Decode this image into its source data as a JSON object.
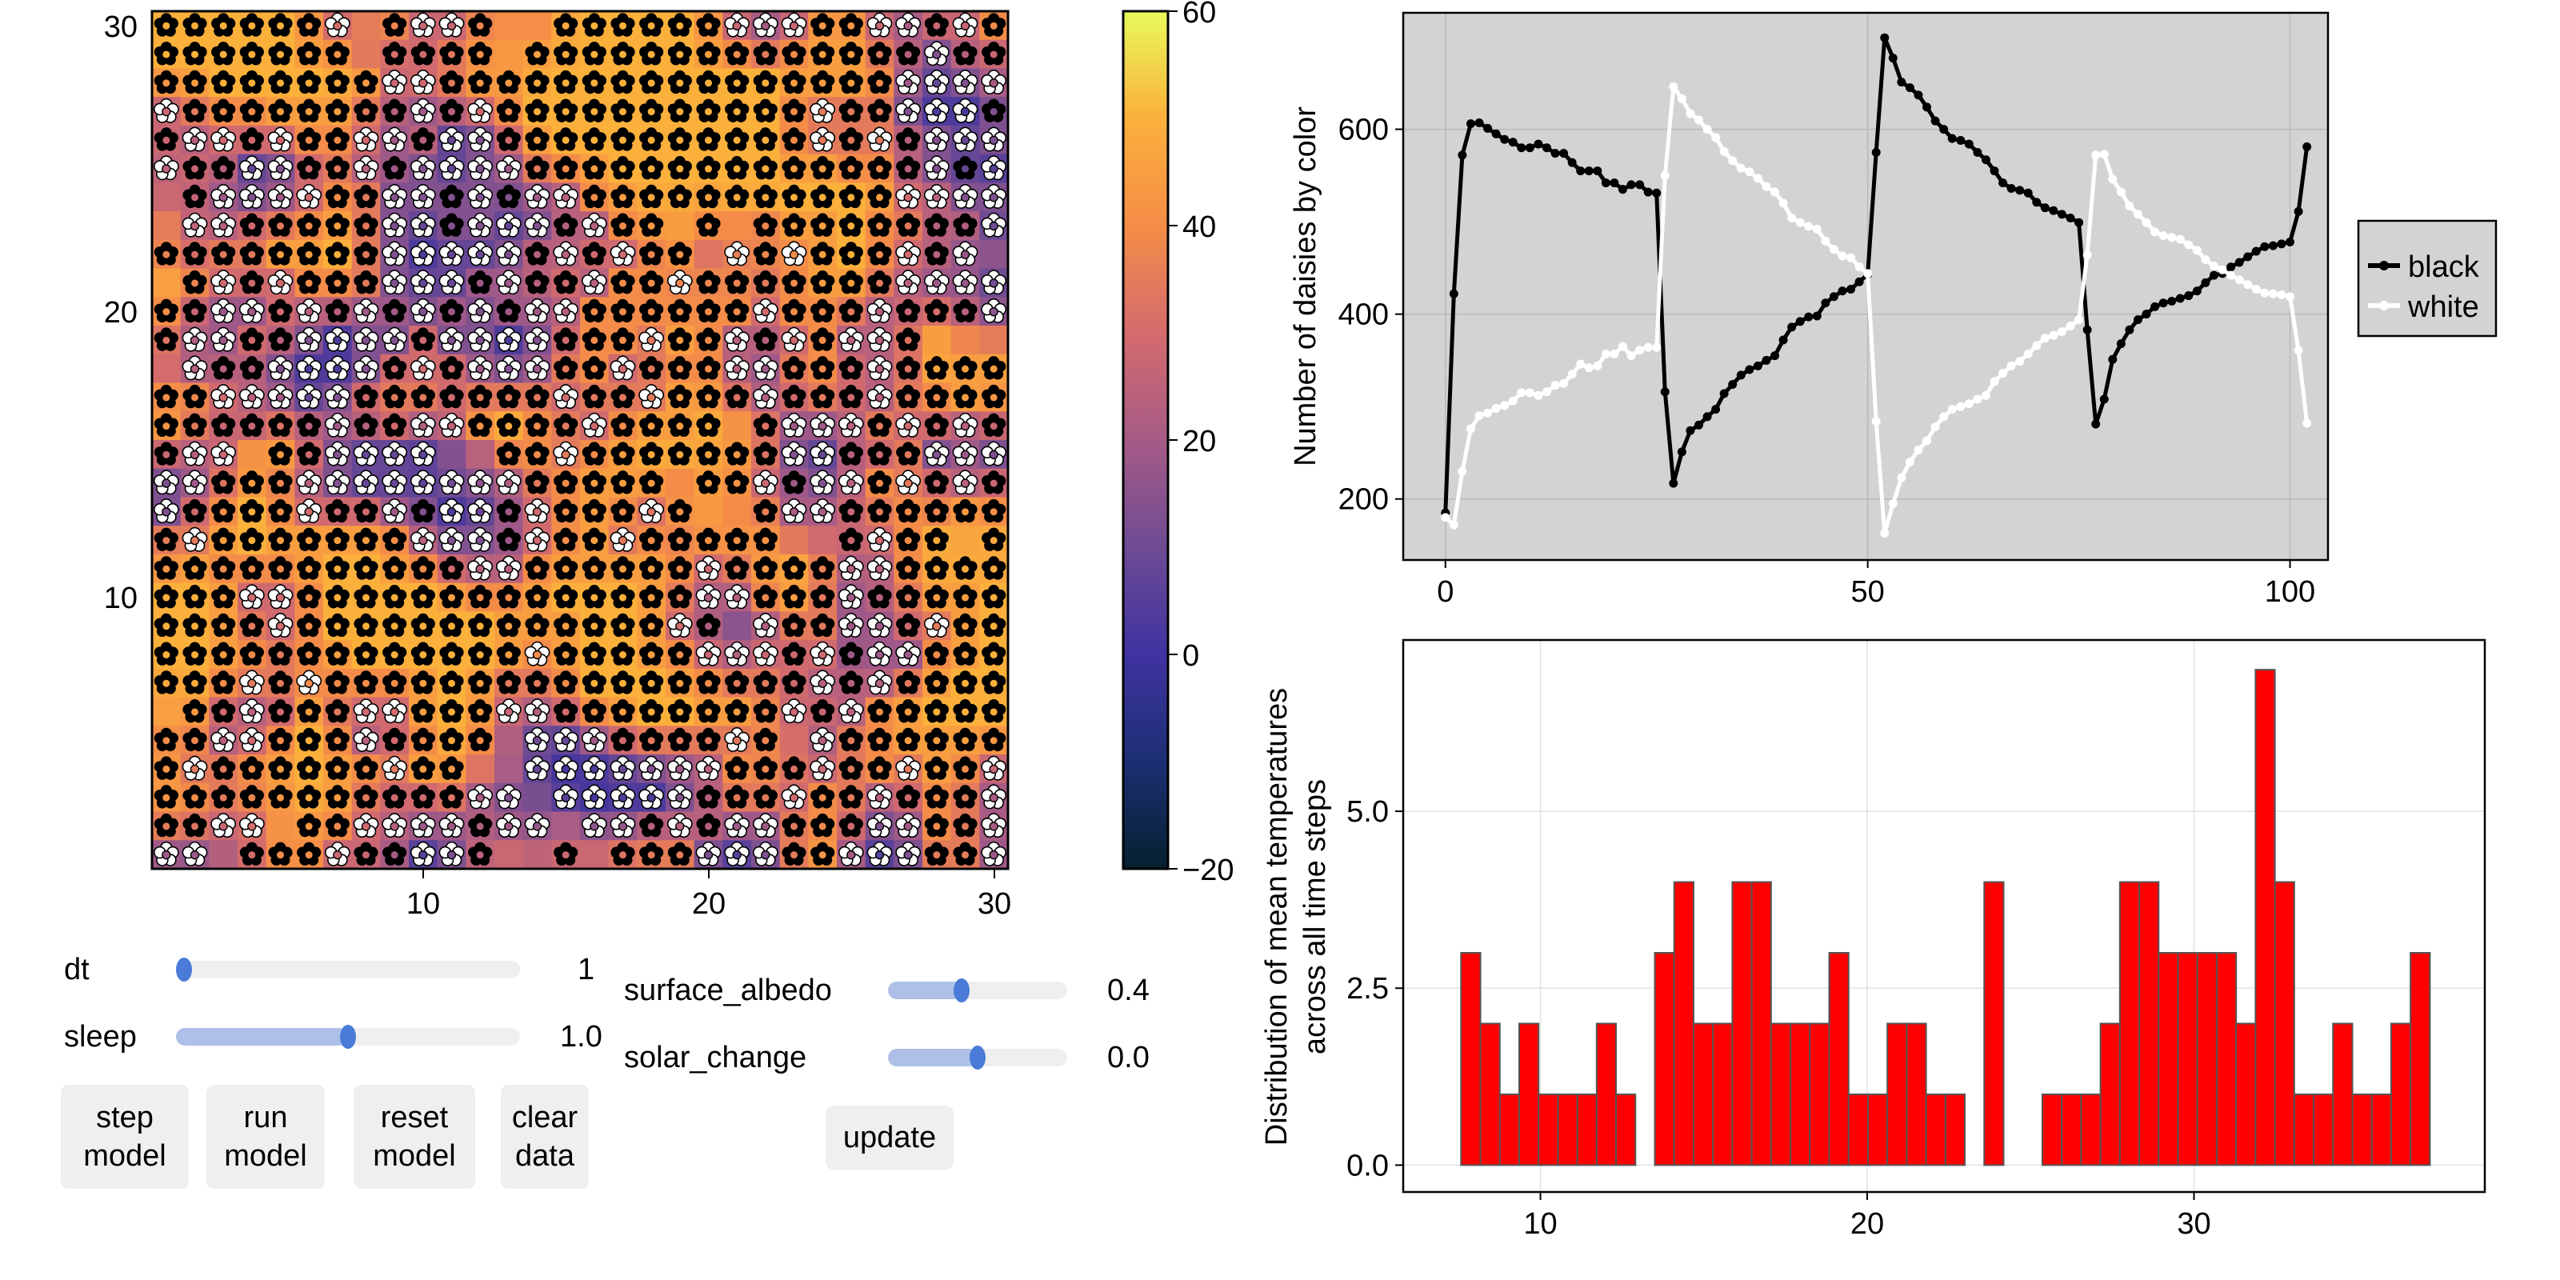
{
  "heatmap": {
    "x_ticks": [
      "10",
      "20",
      "30"
    ],
    "y_ticks": [
      "10",
      "20",
      "30"
    ],
    "daisy_legend": {
      "B": "black daisy",
      "W": "white daisy",
      ".": "empty"
    },
    "rows_top_to_bottom": [
      "BBBBBBW.BWWB..BBBBBBWWWBBWWBWB",
      "BBBBBBB.BBBB.BBBBBBBBBBBBBBWBB",
      "BBBBBBBBWWBBBBBBBBBBBBBBBBWWWW",
      "WBBBBBBBBWBWBBBBBBBBBBBWBBWWWB",
      "BWWBWBBWWBWWBBBBBBBBBBBWBWBWWW",
      "WBBWWBBWBWWWWBBBBBBBBBBBBBBWBW",
      ".BWWWWBBWWBWBWWBBBBBBBBBBBWWWW",
      ".WWBBBBBWWBWWWBWBB.B.BBBBBBBBW",
      "BBBBBBBBWWWWWBWBWBB.WBWBBBWBW.",
      ".BWBWBBBWWWBWBBWBBWBBBBBBBWWWW",
      "BBWWBWBWBWBWBWWBBBBBBWBBBWBBBW",
      "BWWBBWWWWBWWWWBBBWBBWBWBWWB...",
      ".WBBWWWWBWBWWWBBWBBBWWBBBWBBBB",
      "BBWWWWWBBBBBBBWBBWBBBWBBBWBBBB",
      "BBBBBBWBBWWBBBBWBBBB.BWWWBWBWB",
      "BWW.BBWWWW..BBWBBBBBBBWWBBBWWW",
      "WWBBBWWWWWWWWBBBBB.BBWBWWBWBWB",
      "WBBBBWBBWBWWBWBBBWB..BWWBBBBBB",
      "BWBBBBBBBWWWBWBBWBBBBB..BWBB.B",
      "BBBBBBBBBBBWWBBBBBBWBBBBWWBBBB",
      "BBBWWBBBBBBBBBBBBBBWWBBBWBBBBB",
      "BBBBWBBBBBBBBBBBBBWB.WBBWWBWBB",
      "BBBBBBBBBBBBBWBBBBBWWWBWBWWBBB",
      "BBBWBWBBBBBBBBBBBBBBBBBWBWBBBB",
      ".BBWBBBWWBBBWWBBBBBBBBWBWBBBBB",
      "BBWWBBBWBBBB.WWWBBBBWB.WBBBBBB",
      "BWBBBBBBWBB..WWWWWWWBBBWBBWBBW",
      "BBBBBBBBBBBWW.WWWWWBBBWBBWBBBW",
      "BBWW.BBWWWWBWW.WWBWBWWBBBWWBBW",
      "WW.BBBWBBWWB..B.BBBWWWBBWWWBBW"
    ]
  },
  "colorbar": {
    "ticks": [
      "60",
      "40",
      "20",
      "0",
      "−20"
    ],
    "range": [
      -20,
      60
    ],
    "colors": [
      "#06202f",
      "#1d2f74",
      "#3f33a0",
      "#6e4b94",
      "#a65b86",
      "#d46b6d",
      "#f58d47",
      "#fbb03b",
      "#e8fa5b"
    ]
  },
  "chart_data": [
    {
      "type": "line",
      "ylabel": "Number of daisies by color",
      "xlabel": "",
      "xlim": [
        -5,
        104.5
      ],
      "ylim": [
        134,
        726
      ],
      "x_ticks": [
        "0",
        "50",
        "100"
      ],
      "y_ticks": [
        "200",
        "400",
        "600"
      ],
      "background": "#d3d3d3",
      "legend_position": "right",
      "x": "0..102 (step 1)",
      "series": [
        {
          "name": "black",
          "color": "#000000",
          "values": [
            185,
            422,
            572,
            606,
            607,
            601,
            595,
            589,
            586,
            580,
            580,
            584,
            580,
            574,
            574,
            564,
            555,
            555,
            555,
            542,
            542,
            535,
            540,
            540,
            532,
            531,
            316,
            217,
            251,
            274,
            280,
            289,
            297,
            314,
            324,
            334,
            340,
            344,
            350,
            355,
            372,
            386,
            392,
            397,
            398,
            412,
            419,
            425,
            427,
            435,
            443,
            575,
            699,
            677,
            651,
            645,
            637,
            624,
            609,
            600,
            590,
            588,
            584,
            575,
            567,
            555,
            542,
            536,
            534,
            531,
            521,
            515,
            512,
            508,
            504,
            499,
            383,
            281,
            308,
            351,
            368,
            383,
            394,
            400,
            408,
            412,
            414,
            417,
            420,
            425,
            434,
            442,
            444,
            451,
            456,
            462,
            468,
            473,
            474,
            476,
            478,
            511,
            581
          ]
        },
        {
          "name": "white",
          "color": "#ffffff",
          "values": [
            180,
            172,
            230,
            276,
            290,
            293,
            298,
            301,
            306,
            315,
            315,
            312,
            316,
            323,
            325,
            335,
            346,
            342,
            344,
            357,
            357,
            365,
            355,
            361,
            364,
            364,
            550,
            646,
            633,
            617,
            610,
            600,
            591,
            576,
            566,
            558,
            554,
            547,
            538,
            532,
            520,
            504,
            499,
            495,
            492,
            479,
            470,
            463,
            461,
            451,
            444,
            284,
            163,
            195,
            223,
            240,
            253,
            263,
            278,
            289,
            297,
            300,
            303,
            308,
            312,
            327,
            336,
            344,
            349,
            357,
            366,
            374,
            377,
            381,
            387,
            394,
            464,
            572,
            573,
            546,
            532,
            517,
            508,
            499,
            489,
            485,
            483,
            481,
            475,
            469,
            459,
            452,
            448,
            442,
            437,
            432,
            427,
            423,
            422,
            421,
            419,
            361,
            282
          ]
        }
      ]
    },
    {
      "type": "bar",
      "ylabel": "Distribution of mean temperatures",
      "ylabel2": "across all time steps",
      "xlabel": "",
      "xlim": [
        5.8,
        38.9
      ],
      "ylim": [
        -0.38,
        7.42
      ],
      "x_ticks": [
        "10",
        "20",
        "30"
      ],
      "y_ticks": [
        "0.0",
        "2.5",
        "5.0"
      ],
      "bar_color": "#ff0000",
      "bin_start": 7.57,
      "bin_width": 0.593,
      "values": [
        3,
        2,
        1,
        2,
        1,
        1,
        1,
        2,
        1,
        0,
        3,
        4,
        2,
        2,
        4,
        4,
        2,
        2,
        2,
        3,
        1,
        1,
        2,
        2,
        1,
        1,
        0,
        4,
        0,
        0,
        1,
        1,
        1,
        2,
        4,
        4,
        3,
        3,
        3,
        3,
        2,
        7,
        4,
        1,
        1,
        2,
        1,
        1,
        2,
        3
      ]
    }
  ],
  "controls": {
    "sliders": [
      {
        "label": "dt",
        "value": "1",
        "fill_fraction": 0.0
      },
      {
        "label": "sleep",
        "value": "1.0",
        "fill_fraction": 0.5
      },
      {
        "label": "surface_albedo",
        "value": "0.4",
        "fill_fraction": 0.41
      },
      {
        "label": "solar_change",
        "value": "0.0",
        "fill_fraction": 0.5
      }
    ],
    "buttons": [
      {
        "line1": "step",
        "line2": "model"
      },
      {
        "line1": "run",
        "line2": "model"
      },
      {
        "line1": "reset",
        "line2": "model"
      },
      {
        "line1": "clear",
        "line2": "data"
      }
    ],
    "update_label": "update",
    "accent": "#4b7bd8"
  }
}
